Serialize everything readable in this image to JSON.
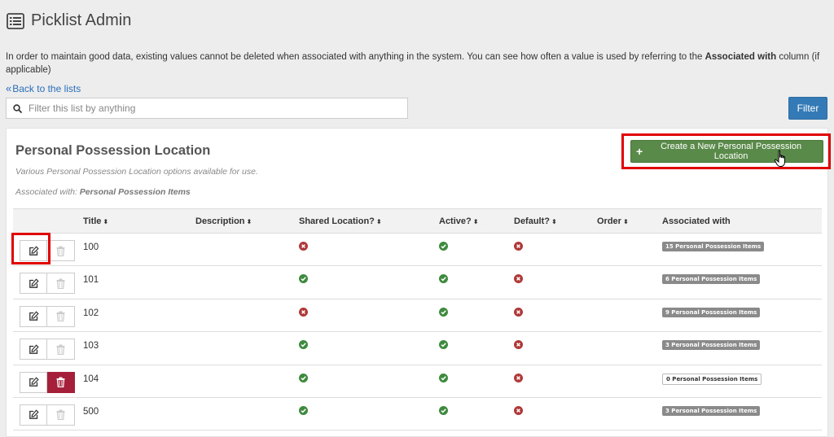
{
  "header": {
    "title": "Picklist Admin",
    "icon": "list-icon"
  },
  "info": {
    "text_before": "In order to maintain good data, existing values cannot be deleted when associated with anything in the system. You can see how often a value is used by referring to the ",
    "bold": "Associated with",
    "text_after": " column (if applicable)"
  },
  "back_link": {
    "label": "Back to the lists",
    "icon": "double-chevron-left-icon"
  },
  "search": {
    "placeholder": "Filter this list by anything",
    "value": "",
    "icon": "search-icon"
  },
  "filter_button": {
    "label": "Filter"
  },
  "panel": {
    "title": "Personal Possession Location",
    "description": "Various Personal Possession Location options available for use.",
    "associated_prefix": "Associated with: ",
    "associated_value": "Personal Possession Items",
    "create_button": "Create a New Personal Possession Location"
  },
  "table": {
    "columns": [
      "Title",
      "Description",
      "Shared Location?",
      "Active?",
      "Default?",
      "Order",
      "Associated with"
    ],
    "sort_glyph": "⬍",
    "rows": [
      {
        "title": "100",
        "description": "",
        "shared": false,
        "active": true,
        "default": false,
        "order": "",
        "associated": "15 Personal Possession Items",
        "delete_enabled": false
      },
      {
        "title": "101",
        "description": "",
        "shared": true,
        "active": true,
        "default": false,
        "order": "",
        "associated": "6 Personal Possession Items",
        "delete_enabled": false
      },
      {
        "title": "102",
        "description": "",
        "shared": false,
        "active": true,
        "default": false,
        "order": "",
        "associated": "9 Personal Possession Items",
        "delete_enabled": false
      },
      {
        "title": "103",
        "description": "",
        "shared": true,
        "active": true,
        "default": false,
        "order": "",
        "associated": "3 Personal Possession Items",
        "delete_enabled": false
      },
      {
        "title": "104",
        "description": "",
        "shared": true,
        "active": true,
        "default": false,
        "order": "",
        "associated": "0 Personal Possession Items",
        "delete_enabled": true
      },
      {
        "title": "500",
        "description": "",
        "shared": true,
        "active": true,
        "default": false,
        "order": "",
        "associated": "3 Personal Possession Items",
        "delete_enabled": false
      }
    ]
  },
  "colors": {
    "primary": "#337ab7",
    "success": "#5a8a4a",
    "check": "#3e8a3e",
    "cross": "#b03838",
    "danger": "#a51f3a",
    "highlight": "#e00000"
  }
}
